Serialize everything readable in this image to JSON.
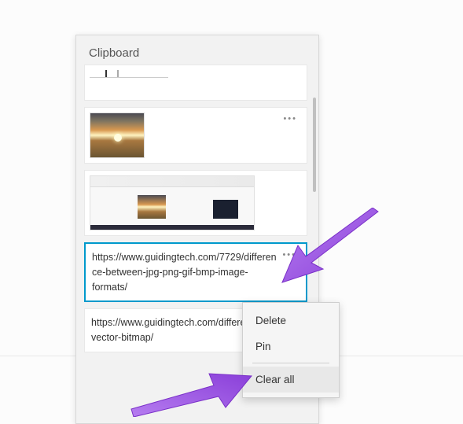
{
  "panel": {
    "title": "Clipboard"
  },
  "items": [
    {
      "type": "image-partial"
    },
    {
      "type": "image-sunset"
    },
    {
      "type": "image-screenshot"
    },
    {
      "type": "text",
      "text": "https://www.guidingtech.com/7729/difference-between-jpg-png-gif-bmp-image-formats/",
      "selected": true
    },
    {
      "type": "text",
      "text": "https://www.guidingtech.com/difference-vector-bitmap/",
      "selected": false
    }
  ],
  "context_menu": {
    "delete": "Delete",
    "pin": "Pin",
    "clear_all": "Clear all"
  },
  "colors": {
    "accent_arrow": "#a259e6",
    "selection_border": "#0099cc"
  }
}
